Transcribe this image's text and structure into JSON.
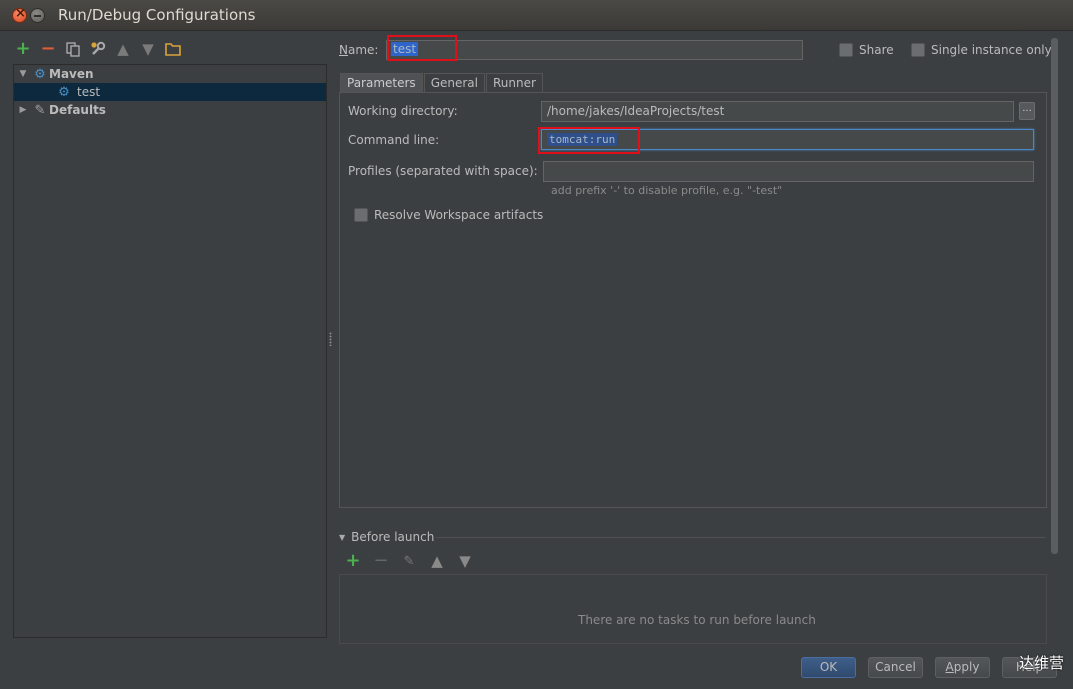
{
  "window": {
    "title": "Run/Debug Configurations"
  },
  "left_toolbar": {
    "icons": [
      "add-icon",
      "remove-icon",
      "copy-icon",
      "edit-defaults-icon",
      "move-up-icon",
      "move-down-icon",
      "folder-icon"
    ],
    "colors": {
      "add": "#4caf50",
      "remove": "#e05c3a",
      "folder": "#d9a33a"
    }
  },
  "tree": {
    "items": [
      {
        "label": "Maven",
        "expanded": true,
        "bold": true
      },
      {
        "label": "test",
        "selected": true
      },
      {
        "label": "Defaults",
        "expanded": false,
        "bold": true
      }
    ]
  },
  "header": {
    "name_label": "Name:",
    "name_value": "test",
    "share_label": "Share",
    "single_instance_label": "Single instance only"
  },
  "tabs": [
    {
      "label": "Parameters",
      "active": true
    },
    {
      "label": "General",
      "active": false
    },
    {
      "label": "Runner",
      "active": false
    }
  ],
  "parameters": {
    "working_dir_label": "Working directory:",
    "working_dir_value": "/home/jakes/IdeaProjects/test",
    "browse_label": "...",
    "command_line_label": "Command line:",
    "command_line_value": "tomcat:run",
    "profiles_label": "Profiles (separated with space):",
    "profiles_value": "",
    "profiles_hint": "add prefix '-' to disable profile, e.g. \"-test\"",
    "resolve_label": "Resolve Workspace artifacts"
  },
  "before_launch": {
    "title": "Before launch",
    "empty_text": "There are no tasks to run before launch"
  },
  "buttons": {
    "ok": "OK",
    "cancel": "Cancel",
    "apply": "Apply",
    "help": "Help"
  },
  "watermark": "达维营",
  "colors": {
    "background": "#3c3f41",
    "selection": "#0d293e",
    "highlight_border": "#e0101a",
    "text_selection": "#2f65ca"
  }
}
